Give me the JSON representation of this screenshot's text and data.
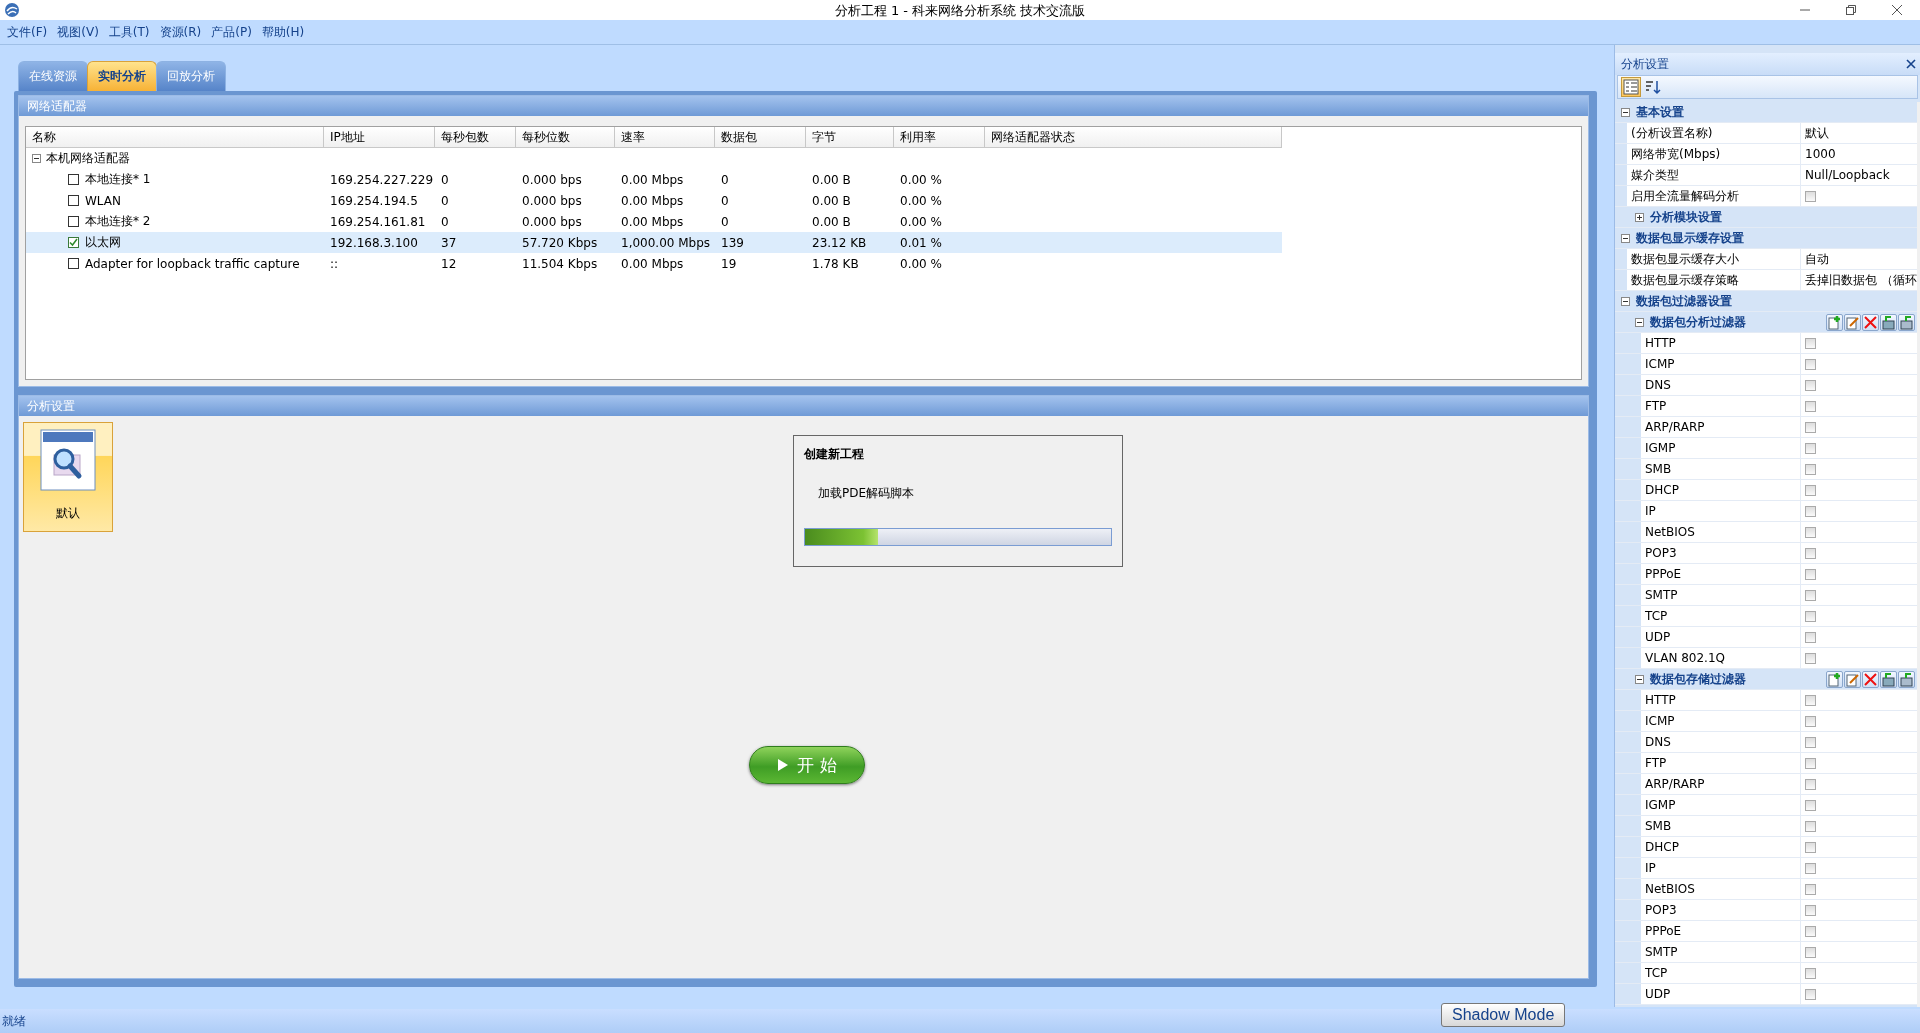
{
  "window": {
    "title": "分析工程 1 - 科来网络分析系统 技术交流版"
  },
  "menu": [
    "文件(F)",
    "视图(V)",
    "工具(T)",
    "资源(R)",
    "产品(P)",
    "帮助(H)"
  ],
  "tabs": [
    {
      "label": "在线资源",
      "selected": false
    },
    {
      "label": "实时分析",
      "selected": true
    },
    {
      "label": "回放分析",
      "selected": false
    }
  ],
  "adapters": {
    "title": "网络适配器",
    "columns": [
      "名称",
      "IP地址",
      "每秒包数",
      "每秒位数",
      "速率",
      "数据包",
      "字节",
      "利用率",
      "网络适配器状态"
    ],
    "groups": [
      {
        "name": "本机网络适配器",
        "expanded": true,
        "rows": [
          {
            "checked": false,
            "selected": false,
            "cells": [
              "本地连接* 1",
              "169.254.227.229",
              "0",
              "0.000 bps",
              "0.00 Mbps",
              "0",
              "0.00 B",
              "0.00 %"
            ]
          },
          {
            "checked": false,
            "selected": false,
            "cells": [
              "WLAN",
              "169.254.194.5",
              "0",
              "0.000 bps",
              "0.00 Mbps",
              "0",
              "0.00 B",
              "0.00 %"
            ]
          },
          {
            "checked": false,
            "selected": false,
            "cells": [
              "本地连接* 2",
              "169.254.161.81",
              "0",
              "0.000 bps",
              "0.00 Mbps",
              "0",
              "0.00 B",
              "0.00 %"
            ]
          },
          {
            "checked": true,
            "selected": true,
            "cells": [
              "以太网",
              "192.168.3.100",
              "37",
              "57.720 Kbps",
              "1,000.00 Mbps",
              "139",
              "23.12 KB",
              "0.01 %"
            ]
          },
          {
            "checked": false,
            "selected": false,
            "cells": [
              "Adapter for loopback traffic capture",
              "::",
              "12",
              "11.504 Kbps",
              "0.00 Mbps",
              "19",
              "1.78 KB",
              "0.00 %"
            ]
          }
        ]
      }
    ]
  },
  "analysis": {
    "title": "分析设置",
    "profiles": [
      {
        "label": "默认",
        "selected": true
      }
    ],
    "dialog": {
      "title": "创建新工程",
      "message": "加载PDE解码脚本",
      "level": 0.24
    },
    "start_button": "开 始"
  },
  "property_panel": {
    "title": "分析设置",
    "sort_modes": [
      {
        "kind": "categorized",
        "selected": true
      },
      {
        "kind": "alphabetical",
        "selected": false
      }
    ],
    "sections": [
      {
        "name": "基本设置",
        "expanded": true,
        "items": [
          {
            "kind": "text",
            "label": "(分析设置名称)",
            "value": "默认"
          },
          {
            "kind": "text",
            "label": "网络带宽(Mbps)",
            "value": "1000"
          },
          {
            "kind": "text",
            "label": "媒介类型",
            "value": "Null/Loopback"
          },
          {
            "kind": "checkbox",
            "label": "启用全流量解码分析",
            "checked": false
          },
          {
            "kind": "group",
            "name": "分析模块设置",
            "expanded": false
          }
        ]
      },
      {
        "name": "数据包显示缓存设置",
        "expanded": true,
        "items": [
          {
            "kind": "text",
            "label": "数据包显示缓存大小",
            "value": "自动"
          },
          {
            "kind": "text",
            "label": "数据包显示缓存策略",
            "value": "丢掉旧数据包 （循环"
          }
        ]
      },
      {
        "name": "数据包过滤器设置",
        "expanded": true,
        "items": [
          {
            "kind": "filter_group",
            "name": "数据包分析过滤器",
            "expanded": true,
            "items": [
              {
                "kind": "checkbox",
                "label": "HTTP",
                "checked": false
              },
              {
                "kind": "checkbox",
                "label": "ICMP",
                "checked": false
              },
              {
                "kind": "checkbox",
                "label": "DNS",
                "checked": false
              },
              {
                "kind": "checkbox",
                "label": "FTP",
                "checked": false
              },
              {
                "kind": "checkbox",
                "label": "ARP/RARP",
                "checked": false
              },
              {
                "kind": "checkbox",
                "label": "IGMP",
                "checked": false
              },
              {
                "kind": "checkbox",
                "label": "SMB",
                "checked": false
              },
              {
                "kind": "checkbox",
                "label": "DHCP",
                "checked": false
              },
              {
                "kind": "checkbox",
                "label": "IP",
                "checked": false
              },
              {
                "kind": "checkbox",
                "label": "NetBIOS",
                "checked": false
              },
              {
                "kind": "checkbox",
                "label": "POP3",
                "checked": false
              },
              {
                "kind": "checkbox",
                "label": "PPPoE",
                "checked": false
              },
              {
                "kind": "checkbox",
                "label": "SMTP",
                "checked": false
              },
              {
                "kind": "checkbox",
                "label": "TCP",
                "checked": false
              },
              {
                "kind": "checkbox",
                "label": "UDP",
                "checked": false
              },
              {
                "kind": "checkbox",
                "label": "VLAN 802.1Q",
                "checked": false
              }
            ]
          },
          {
            "kind": "filter_group",
            "name": "数据包存储过滤器",
            "expanded": true,
            "items": [
              {
                "kind": "checkbox",
                "label": "HTTP",
                "checked": false
              },
              {
                "kind": "checkbox",
                "label": "ICMP",
                "checked": false
              },
              {
                "kind": "checkbox",
                "label": "DNS",
                "checked": false
              },
              {
                "kind": "checkbox",
                "label": "FTP",
                "checked": false
              },
              {
                "kind": "checkbox",
                "label": "ARP/RARP",
                "checked": false
              },
              {
                "kind": "checkbox",
                "label": "IGMP",
                "checked": false
              },
              {
                "kind": "checkbox",
                "label": "SMB",
                "checked": false
              },
              {
                "kind": "checkbox",
                "label": "DHCP",
                "checked": false
              },
              {
                "kind": "checkbox",
                "label": "IP",
                "checked": false
              },
              {
                "kind": "checkbox",
                "label": "NetBIOS",
                "checked": false
              },
              {
                "kind": "checkbox",
                "label": "POP3",
                "checked": false
              },
              {
                "kind": "checkbox",
                "label": "PPPoE",
                "checked": false
              },
              {
                "kind": "checkbox",
                "label": "SMTP",
                "checked": false
              },
              {
                "kind": "checkbox",
                "label": "TCP",
                "checked": false
              },
              {
                "kind": "checkbox",
                "label": "UDP",
                "checked": false
              }
            ]
          }
        ]
      }
    ]
  },
  "status_bar": {
    "text": "就绪",
    "button": "Shadow Mode"
  }
}
